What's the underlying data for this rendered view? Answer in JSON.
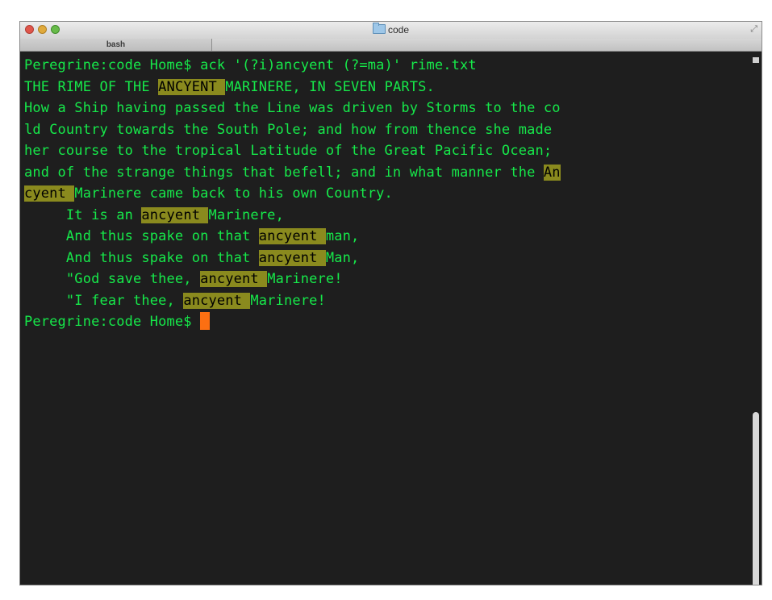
{
  "window": {
    "title": "code",
    "tab_label": "bash"
  },
  "terminal": {
    "lines": [
      [
        {
          "t": "Peregrine:code Home$ ack '(?i)ancyent (?=ma)' rime.txt",
          "h": false
        }
      ],
      [
        {
          "t": "THE RIME OF THE ",
          "h": false
        },
        {
          "t": "ANCYENT ",
          "h": true
        },
        {
          "t": "MARINERE, IN SEVEN PARTS.",
          "h": false
        }
      ],
      [
        {
          "t": "How a Ship having passed the Line was driven by Storms to the co",
          "h": false
        }
      ],
      [
        {
          "t": "ld Country towards the South Pole; and how from thence she made",
          "h": false
        }
      ],
      [
        {
          "t": "her course to the tropical Latitude of the Great Pacific Ocean;",
          "h": false
        }
      ],
      [
        {
          "t": "and of the strange things that befell; and in what manner the ",
          "h": false
        },
        {
          "t": "An",
          "h": true
        }
      ],
      [
        {
          "t": "cyent ",
          "h": true
        },
        {
          "t": "Marinere came back to his own Country.",
          "h": false
        }
      ],
      [
        {
          "t": "     It is an ",
          "h": false
        },
        {
          "t": "ancyent ",
          "h": true
        },
        {
          "t": "Marinere,",
          "h": false
        }
      ],
      [
        {
          "t": "     And thus spake on that ",
          "h": false
        },
        {
          "t": "ancyent ",
          "h": true
        },
        {
          "t": "man,",
          "h": false
        }
      ],
      [
        {
          "t": "     And thus spake on that ",
          "h": false
        },
        {
          "t": "ancyent ",
          "h": true
        },
        {
          "t": "Man,",
          "h": false
        }
      ],
      [
        {
          "t": "     \"God save thee, ",
          "h": false
        },
        {
          "t": "ancyent ",
          "h": true
        },
        {
          "t": "Marinere!",
          "h": false
        }
      ],
      [
        {
          "t": "     \"I fear thee, ",
          "h": false
        },
        {
          "t": "ancyent ",
          "h": true
        },
        {
          "t": "Marinere!",
          "h": false
        }
      ],
      [
        {
          "t": "Peregrine:code Home$ ",
          "h": false
        }
      ]
    ]
  },
  "colors": {
    "text": "#16e94a",
    "highlight_bg": "#8a8a1e",
    "highlight_text": "#000000",
    "cursor": "#fc6f12",
    "background": "#1e1e1e"
  }
}
